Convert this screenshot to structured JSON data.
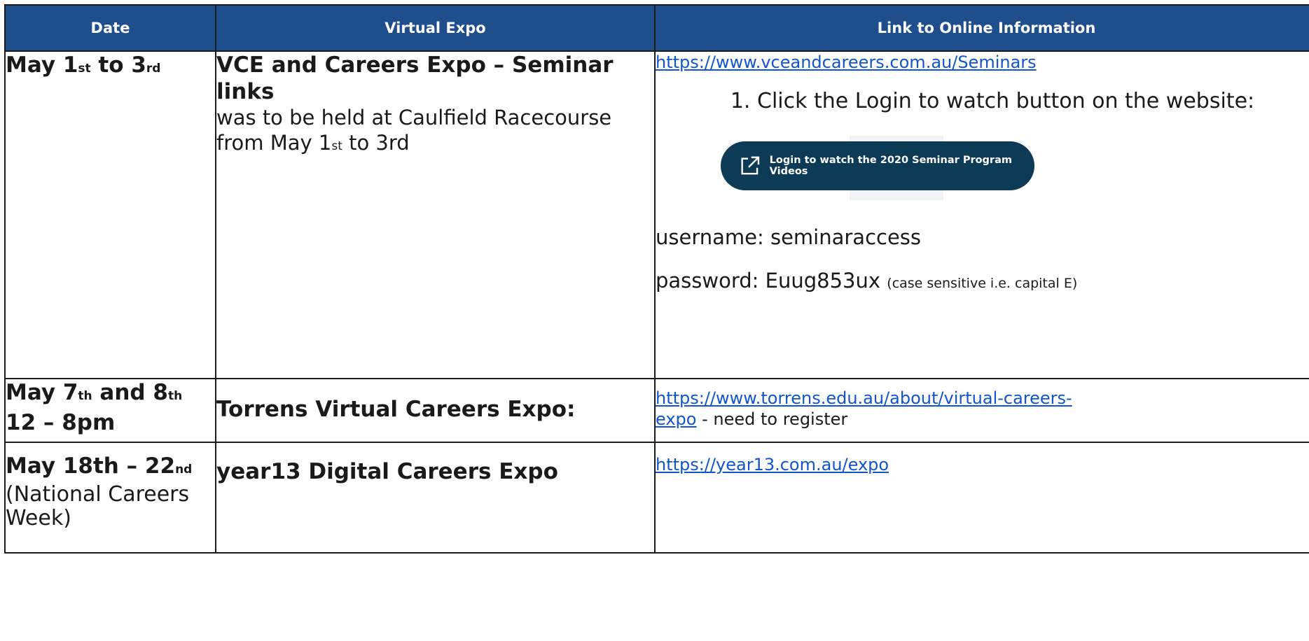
{
  "headers": {
    "date": "Date",
    "expo": "Virtual Expo",
    "link": "Link to Online Information"
  },
  "row1": {
    "date_main": "May 1",
    "date_sup1": "st",
    "date_mid": " to 3",
    "date_sup2": "rd",
    "expo_title": "VCE and Careers Expo – Seminar links",
    "expo_desc_a": "was to be held at Caulfield Racecourse from May 1",
    "expo_desc_sup": "st",
    "expo_desc_b": " to 3rd",
    "link_url": "https://www.vceandcareers.com.au/Seminars",
    "step1": "Click the Login to watch button on the website:",
    "button_label": "Login to watch the 2020 Seminar Program Videos",
    "button_icon": "external-link-icon",
    "username_text": "username: seminaraccess",
    "password_text": "password: Euug853ux",
    "password_note": "(case sensitive i.e. capital E)"
  },
  "row2": {
    "date_a": "May 7",
    "date_sup1": "th",
    "date_b": " and 8",
    "date_sup2": "th",
    "date_line2": "12 –  8pm",
    "expo_title": "Torrens Virtual Careers Expo:",
    "link_url_a": "https://www.torrens.edu.au/about/virtual-careers-",
    "link_url_b": "expo",
    "link_note": "  - need to register"
  },
  "row3": {
    "date_a": "May 18th – 22",
    "date_sup": "nd",
    "date_note": "(National Careers Week)",
    "expo_title": "year13 Digital Careers Expo",
    "link_url": "https://year13.com.au/expo"
  },
  "colors": {
    "header_bg": "#1f4e8c",
    "button_bg": "#0d3a54",
    "link": "#1155cc"
  }
}
